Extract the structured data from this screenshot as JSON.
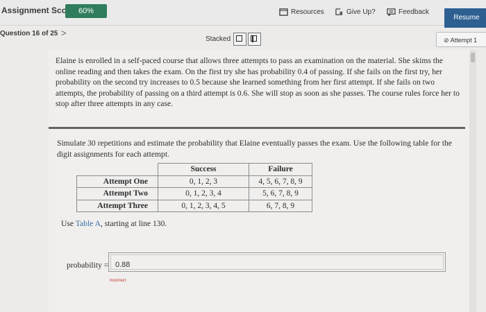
{
  "header": {
    "score_label": "Assignment Score:",
    "score_value": "60%",
    "resources_label": "Resources",
    "giveup_label": "Give Up?",
    "feedback_label": "Feedback",
    "resume_label": "Resume"
  },
  "question_nav": {
    "question_label": "Question 16 of 25",
    "next_chevron": ">",
    "view_mode_label": "Stacked",
    "attempt_label": "Attempt 1"
  },
  "problem": {
    "statement": "Elaine is enrolled in a self-paced course that allows three attempts to pass an examination on the material. She skims the online reading and then takes the exam. On the first try she has probability 0.4 of passing. If she fails on the first try, her probability on the second try increases to 0.5 because she learned something from her first attempt. If she fails on two attempts, the probability of passing on a third attempt is 0.6. She will stop as soon as she passes. The course rules force her to stop after three attempts in any case.",
    "instruction": "Simulate 30 repetitions and estimate the probability that Elaine eventually passes the exam. Use the following table for the digit assignments for each attempt.",
    "table": {
      "headers": [
        "",
        "Success",
        "Failure"
      ],
      "rows": [
        {
          "attempt": "Attempt One",
          "success": "0, 1, 2, 3",
          "failure": "4, 5, 6, 7, 8, 9"
        },
        {
          "attempt": "Attempt Two",
          "success": "0, 1, 2, 3, 4",
          "failure": "5, 6, 7, 8, 9"
        },
        {
          "attempt": "Attempt Three",
          "success": "0, 1, 2, 3, 4, 5",
          "failure": "6, 7, 8, 9"
        }
      ]
    },
    "use_prefix": "Use ",
    "use_link": "Table A",
    "use_suffix": ", starting at line 130."
  },
  "answer": {
    "label": "probability =",
    "value": "0.88",
    "status": "Incorrect"
  },
  "colors": {
    "score_green": "#2f7d5d",
    "resume_blue": "#2d5f91",
    "incorrect_red": "#c0392b",
    "link_blue": "#3a6ea5"
  },
  "icons": [
    "resources-icon",
    "give-up-icon",
    "feedback-icon",
    "attempt-status-icon",
    "chevron-right-icon"
  ]
}
